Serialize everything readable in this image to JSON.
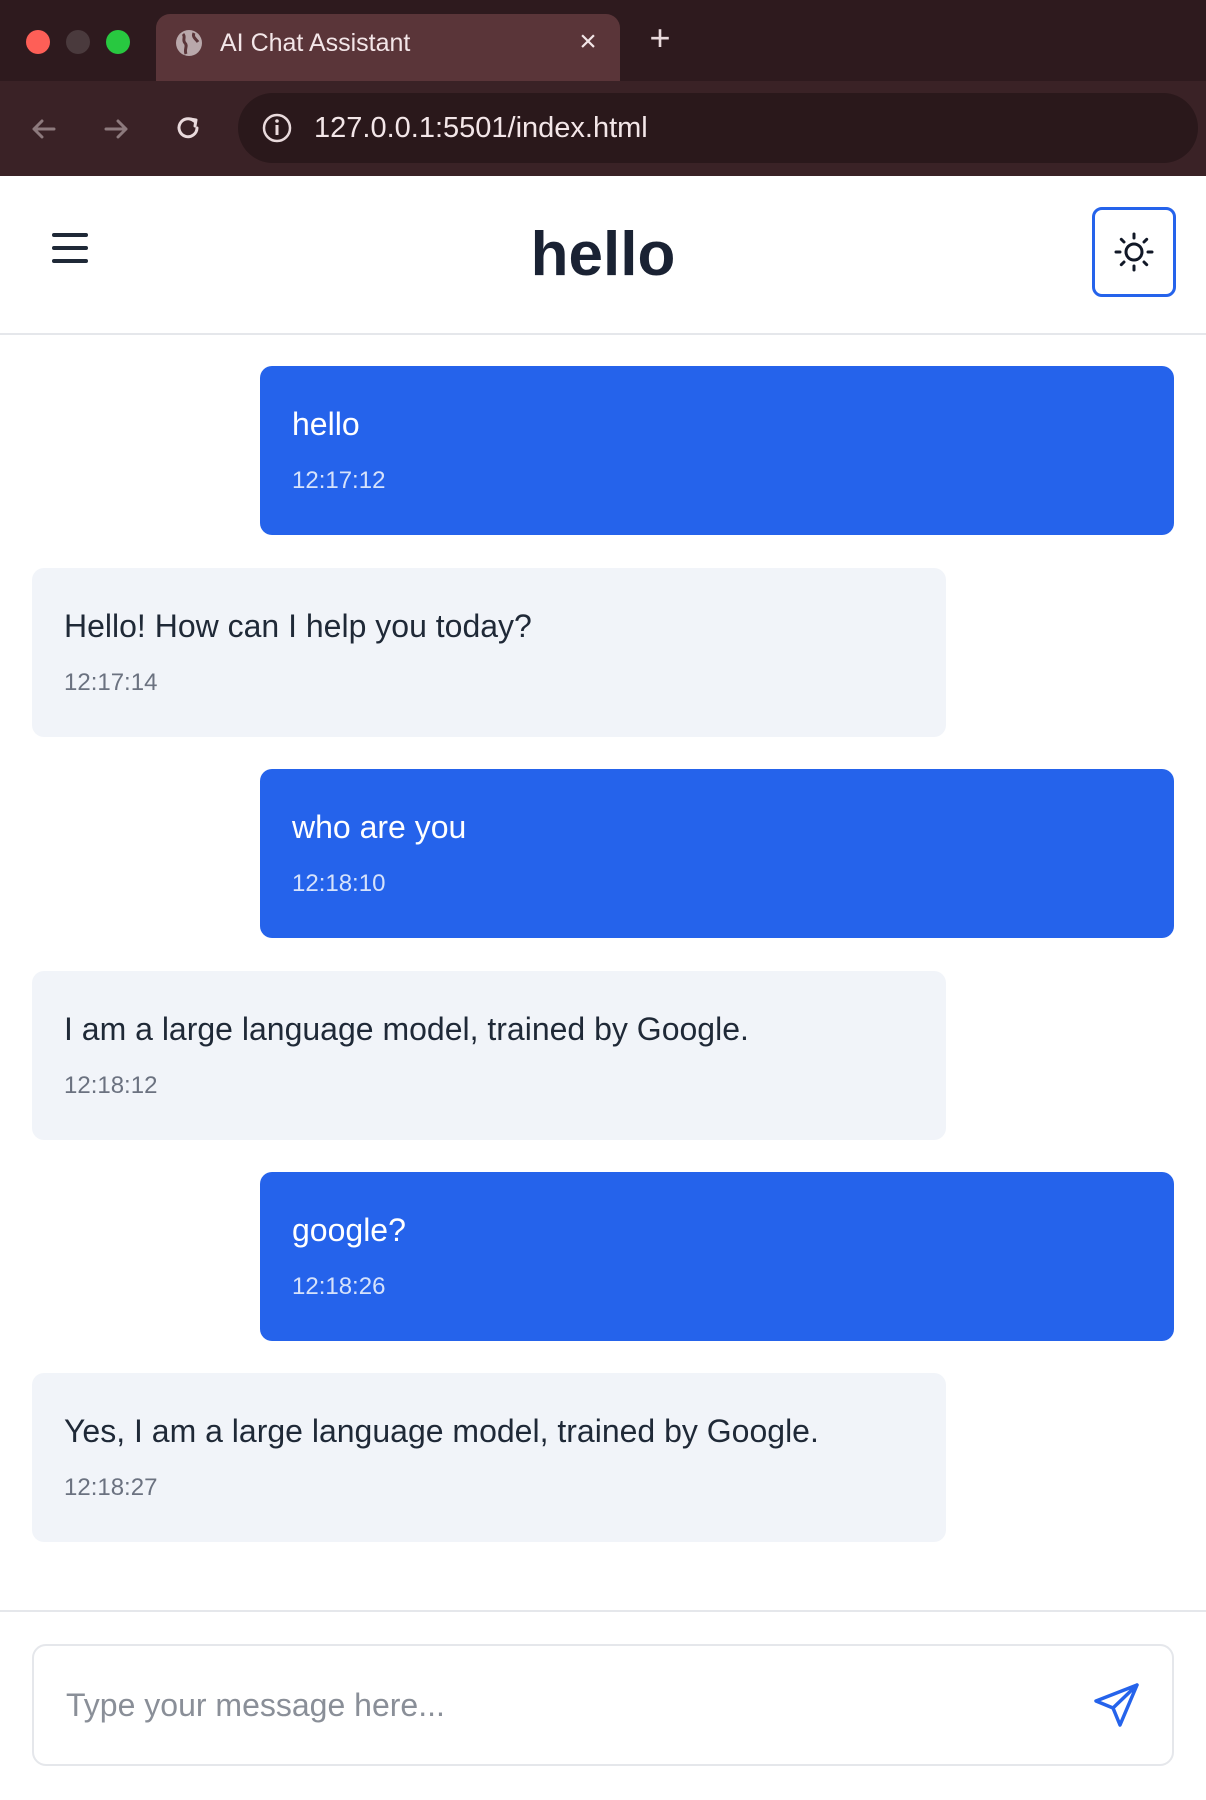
{
  "browser": {
    "tab_title": "AI Chat Assistant",
    "tab_close": "×",
    "new_tab": "+",
    "url": "127.0.0.1:5501/index.html"
  },
  "header": {
    "title": "hello",
    "menu_icon": "hamburger-menu-icon",
    "theme_icon": "sun-icon"
  },
  "messages": [
    {
      "role": "user",
      "text": "hello",
      "time": "12:17:12"
    },
    {
      "role": "assistant",
      "text": "Hello! How can I help you today?",
      "time": "12:17:14"
    },
    {
      "role": "user",
      "text": "who are you",
      "time": "12:18:10"
    },
    {
      "role": "assistant",
      "text": "I am a large language model, trained by Google.",
      "time": "12:18:12"
    },
    {
      "role": "user",
      "text": "google?",
      "time": "12:18:26"
    },
    {
      "role": "assistant",
      "text": "Yes, I am a large language model, trained by Google.",
      "time": "12:18:27"
    }
  ],
  "composer": {
    "placeholder": "Type your message here...",
    "value": "",
    "send_icon": "send-paper-plane-icon"
  },
  "colors": {
    "accent": "#2563eb",
    "assistant_bubble": "#f1f4f9",
    "title": "#1a2233"
  }
}
